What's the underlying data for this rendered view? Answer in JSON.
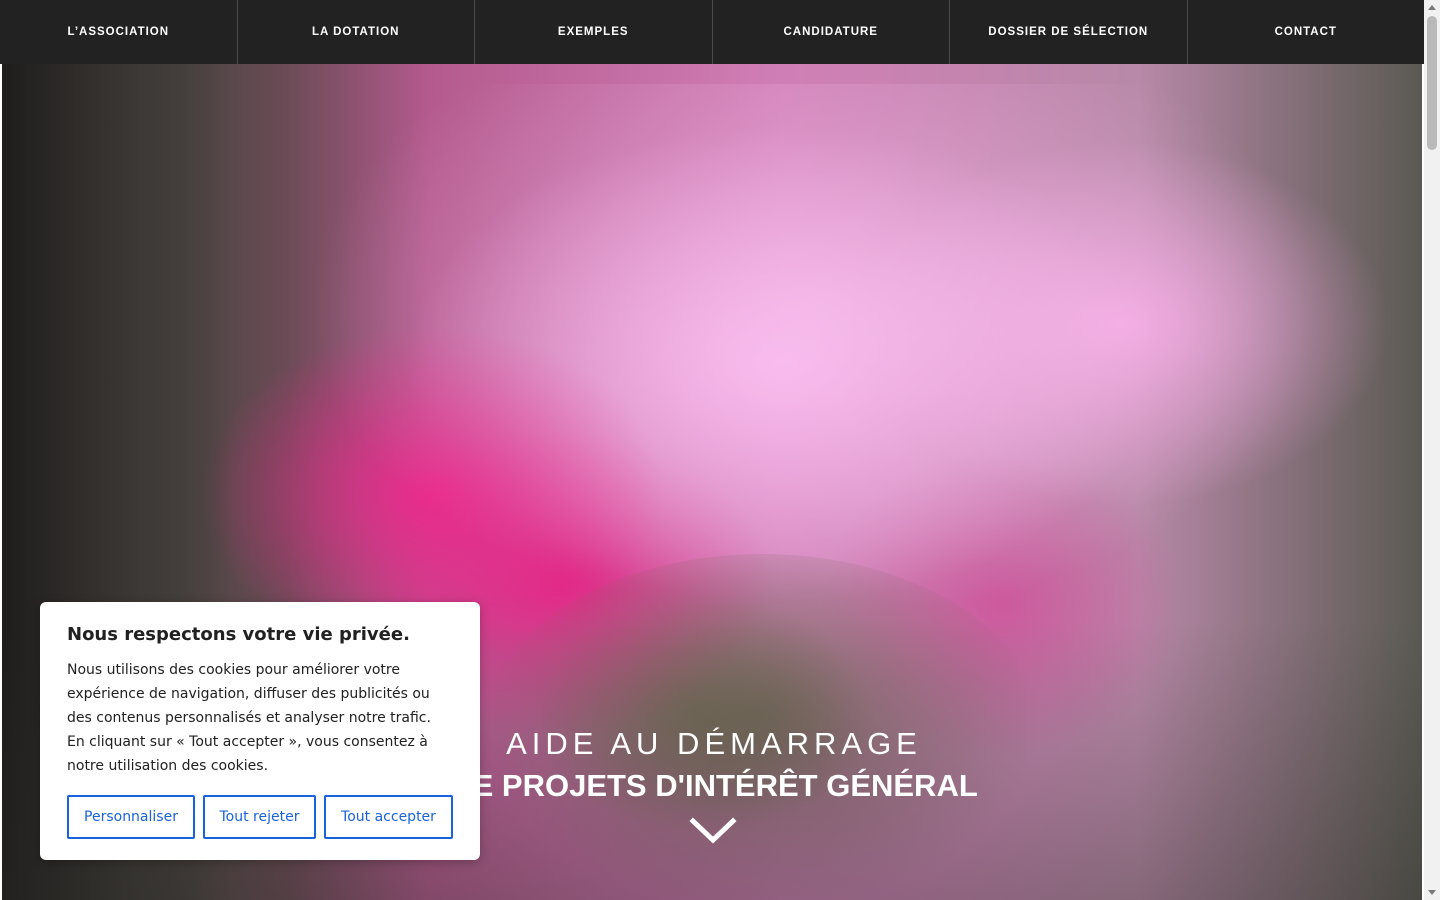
{
  "nav": {
    "items": [
      {
        "label": "L’ASSOCIATION"
      },
      {
        "label": "LA DOTATION"
      },
      {
        "label": "EXEMPLES"
      },
      {
        "label": "CANDIDATURE"
      },
      {
        "label": "DOSSIER DE SÉLECTION"
      },
      {
        "label": "CONTACT"
      }
    ]
  },
  "hero": {
    "tagline_line1": "AIDE AU DÉMARRAGE",
    "tagline_line2": "DE PROJETS D'INTÉRÊT GÉNÉRAL",
    "scroll_icon": "chevron-down-icon"
  },
  "cookie_banner": {
    "title": "Nous respectons votre vie privée.",
    "text": "Nous utilisons des cookies pour améliorer votre expérience de navigation, diffuser des publicités ou des contenus personnalisés et analyser notre trafic. En cliquant sur « Tout accepter », vous consentez à notre utilisation des cookies.",
    "buttons": {
      "customize": "Personnaliser",
      "reject": "Tout rejeter",
      "accept": "Tout accepter"
    }
  },
  "colors": {
    "nav_background": "#222222",
    "button_accent": "#1863dc",
    "hero_pink": "#ec288c"
  }
}
